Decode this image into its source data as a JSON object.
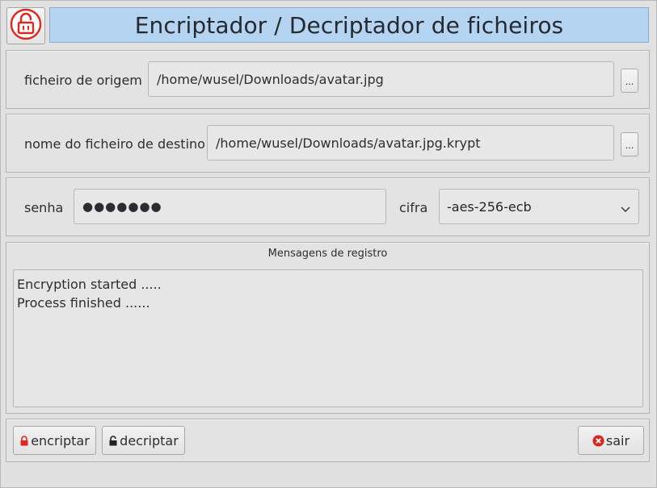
{
  "app": {
    "title": "Encriptador / Decriptador de ficheiros"
  },
  "source": {
    "label": "ficheiro de origem",
    "value": "/home/wusel/Downloads/avatar.jpg",
    "browse_label": "..."
  },
  "destination": {
    "label": "nome do ficheiro de destino",
    "value": "/home/wusel/Downloads/avatar.jpg.krypt",
    "browse_label": "..."
  },
  "password": {
    "label": "senha",
    "masked_value": "●●●●●●●"
  },
  "cipher": {
    "label": "cifra",
    "selected": "-aes-256-ecb"
  },
  "log": {
    "title": "Mensagens de registro",
    "lines": [
      "Encryption started .....",
      "Process finished ......"
    ]
  },
  "actions": {
    "encrypt_label": "encriptar",
    "decrypt_label": "decriptar",
    "exit_label": "sair"
  },
  "colors": {
    "title_bg": "#b5d4f2",
    "lock_red": "#e0261e",
    "exit_red": "#d9261c"
  },
  "icons": {
    "logo": "padlock-open-icon",
    "encrypt": "lock-closed-icon",
    "decrypt": "lock-open-icon",
    "exit": "close-circle-icon",
    "cipher_dropdown": "chevron-down-icon"
  }
}
